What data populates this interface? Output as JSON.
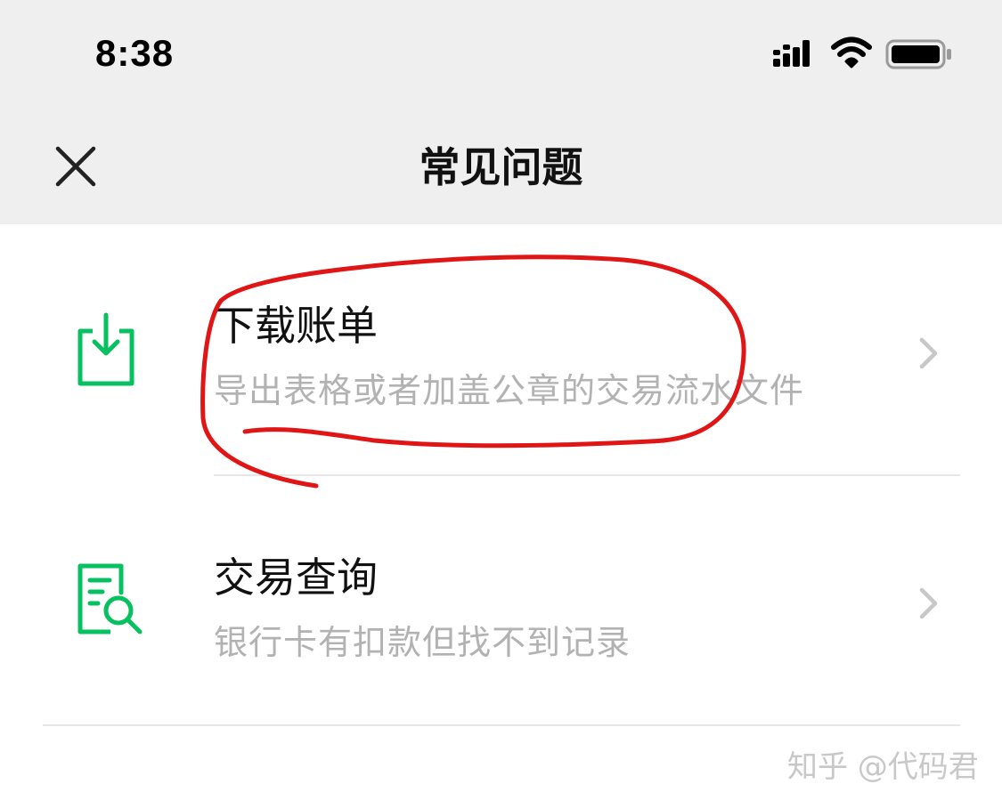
{
  "status_bar": {
    "time": "8:38",
    "icons": [
      "signal-icon",
      "wifi-icon",
      "battery-icon"
    ]
  },
  "header": {
    "title": "常见问题",
    "close_icon": "close-icon"
  },
  "list": {
    "items": [
      {
        "title": "下载账单",
        "subtitle": "导出表格或者加盖公章的交易流水文件",
        "icon": "download-document-icon"
      },
      {
        "title": "交易查询",
        "subtitle": "银行卡有扣款但找不到记录",
        "icon": "search-document-icon"
      }
    ]
  },
  "watermark": "知乎 @代码君",
  "colors": {
    "accent_green": "#07c160",
    "annotation_red": "#e01515",
    "header_bg": "#efefef",
    "subtitle_gray": "#b2b2b2"
  }
}
